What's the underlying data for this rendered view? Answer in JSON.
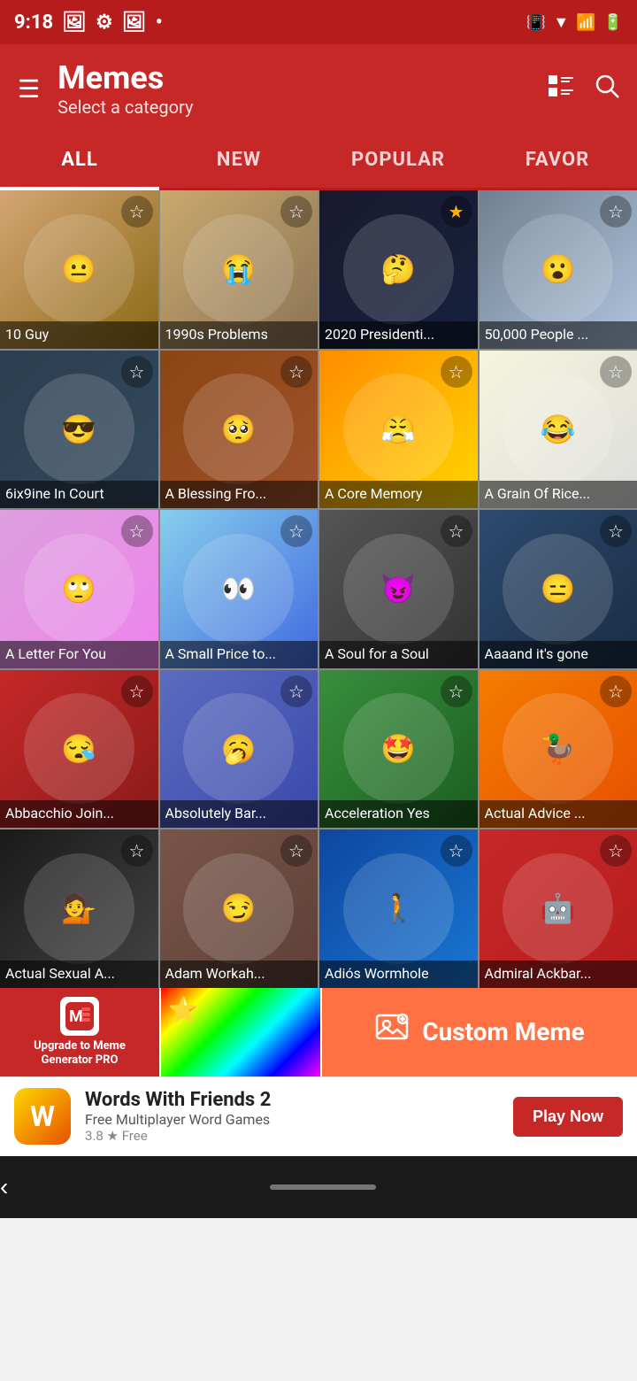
{
  "statusBar": {
    "time": "9:18",
    "icons": [
      "photo",
      "settings",
      "photo",
      "circle"
    ]
  },
  "header": {
    "title": "Memes",
    "subtitle": "Select a category",
    "menuLabel": "☰",
    "listViewLabel": "⊞",
    "searchLabel": "🔍"
  },
  "tabs": [
    {
      "label": "ALL",
      "active": true
    },
    {
      "label": "NEW",
      "active": false
    },
    {
      "label": "POPULAR",
      "active": false
    },
    {
      "label": "FAVOR",
      "active": false
    }
  ],
  "memes": [
    {
      "id": 1,
      "label": "10 Guy",
      "starred": false,
      "bg": "bg-1"
    },
    {
      "id": 2,
      "label": "1990s Problems",
      "starred": false,
      "bg": "bg-2"
    },
    {
      "id": 3,
      "label": "2020 Presidenti...",
      "starred": true,
      "bg": "bg-3"
    },
    {
      "id": 4,
      "label": "50,000 People ...",
      "starred": false,
      "bg": "bg-4"
    },
    {
      "id": 5,
      "label": "6ix9ine In Court",
      "starred": false,
      "bg": "bg-5"
    },
    {
      "id": 6,
      "label": "A Blessing Fro...",
      "starred": false,
      "bg": "bg-6"
    },
    {
      "id": 7,
      "label": "A Core Memory",
      "starred": false,
      "bg": "bg-7"
    },
    {
      "id": 8,
      "label": "A Grain Of Rice...",
      "starred": false,
      "bg": "bg-8"
    },
    {
      "id": 9,
      "label": "A Letter For You",
      "starred": false,
      "bg": "bg-9"
    },
    {
      "id": 10,
      "label": "A Small Price to...",
      "starred": false,
      "bg": "bg-10"
    },
    {
      "id": 11,
      "label": "A Soul for a Soul",
      "starred": false,
      "bg": "bg-11"
    },
    {
      "id": 12,
      "label": "Aaaand it's gone",
      "starred": false,
      "bg": "bg-12"
    },
    {
      "id": 13,
      "label": "Abbacchio Join...",
      "starred": false,
      "bg": "bg-13"
    },
    {
      "id": 14,
      "label": "Absolutely Bar...",
      "starred": false,
      "bg": "bg-14"
    },
    {
      "id": 15,
      "label": "Acceleration Yes",
      "starred": false,
      "bg": "bg-15"
    },
    {
      "id": 16,
      "label": "Actual Advice ...",
      "starred": false,
      "bg": "bg-16"
    },
    {
      "id": 17,
      "label": "Actual Sexual A...",
      "starred": false,
      "bg": "bg-17"
    },
    {
      "id": 18,
      "label": "Adam Workah...",
      "starred": false,
      "bg": "bg-18"
    },
    {
      "id": 19,
      "label": "Adiós Wormhole",
      "starred": false,
      "bg": "bg-19"
    },
    {
      "id": 20,
      "label": "Admiral Ackbar...",
      "starred": false,
      "bg": "bg-20"
    }
  ],
  "bottomBar": {
    "upgradeLabel": "Upgrade to Meme Generator PRO",
    "customMemeLabel": "Custom Meme"
  },
  "ad": {
    "title": "Words With Friends 2",
    "subtitle": "Free Multiplayer Word Games",
    "rating": "3.8 ★  Free",
    "cta": "Play Now"
  },
  "navBar": {
    "backLabel": "‹",
    "homeIndicator": ""
  }
}
